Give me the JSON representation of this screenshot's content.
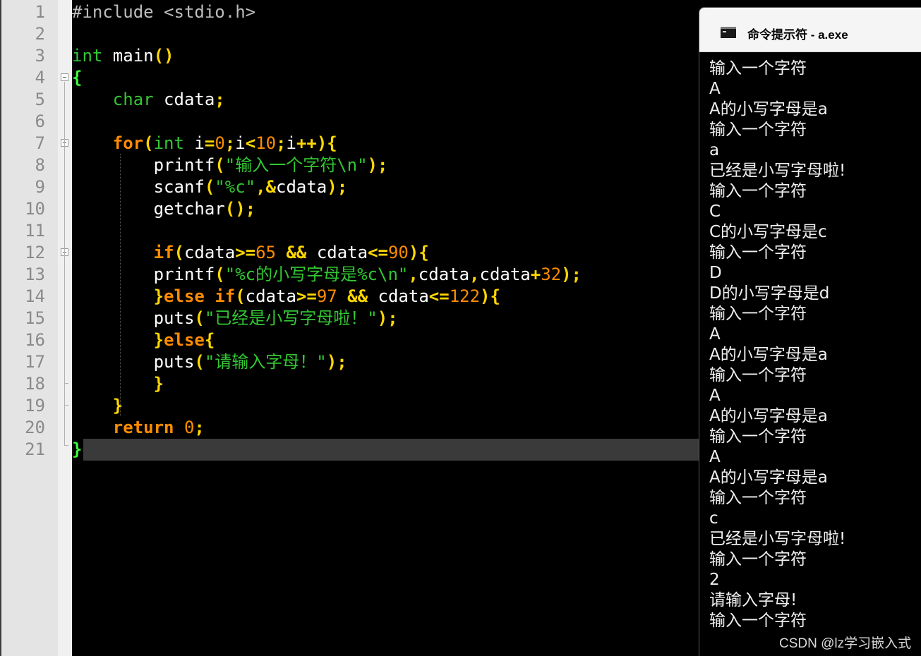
{
  "editor": {
    "code_lines": [
      [
        {
          "t": "#include <stdio.h>",
          "c": "pre"
        }
      ],
      [],
      [
        {
          "t": "int",
          "c": "type"
        },
        {
          "t": " main",
          "c": "id"
        },
        {
          "t": "()",
          "c": "op"
        }
      ],
      [
        {
          "t": "{",
          "c": "brace"
        }
      ],
      [
        {
          "t": "    ",
          "c": "id"
        },
        {
          "t": "char",
          "c": "type"
        },
        {
          "t": " cdata",
          "c": "id"
        },
        {
          "t": ";",
          "c": "op"
        }
      ],
      [],
      [
        {
          "t": "    ",
          "c": "id"
        },
        {
          "t": "for",
          "c": "kw"
        },
        {
          "t": "(",
          "c": "op"
        },
        {
          "t": "int",
          "c": "type"
        },
        {
          "t": " i",
          "c": "id"
        },
        {
          "t": "=",
          "c": "op"
        },
        {
          "t": "0",
          "c": "num"
        },
        {
          "t": ";",
          "c": "op"
        },
        {
          "t": "i",
          "c": "id"
        },
        {
          "t": "<",
          "c": "op"
        },
        {
          "t": "10",
          "c": "num"
        },
        {
          "t": ";",
          "c": "op"
        },
        {
          "t": "i",
          "c": "id"
        },
        {
          "t": "++){",
          "c": "op"
        }
      ],
      [
        {
          "t": "        printf",
          "c": "id"
        },
        {
          "t": "(",
          "c": "op"
        },
        {
          "t": "\"输入一个字符\\n\"",
          "c": "str"
        },
        {
          "t": ");",
          "c": "op"
        }
      ],
      [
        {
          "t": "        scanf",
          "c": "id"
        },
        {
          "t": "(",
          "c": "op"
        },
        {
          "t": "\"%c\"",
          "c": "str"
        },
        {
          "t": ",&",
          "c": "op"
        },
        {
          "t": "cdata",
          "c": "id"
        },
        {
          "t": ");",
          "c": "op"
        }
      ],
      [
        {
          "t": "        getchar",
          "c": "id"
        },
        {
          "t": "();",
          "c": "op"
        }
      ],
      [],
      [
        {
          "t": "        ",
          "c": "id"
        },
        {
          "t": "if",
          "c": "kw"
        },
        {
          "t": "(",
          "c": "op"
        },
        {
          "t": "cdata",
          "c": "id"
        },
        {
          "t": ">=",
          "c": "op"
        },
        {
          "t": "65",
          "c": "num"
        },
        {
          "t": " ",
          "c": "id"
        },
        {
          "t": "&&",
          "c": "op"
        },
        {
          "t": " cdata",
          "c": "id"
        },
        {
          "t": "<=",
          "c": "op"
        },
        {
          "t": "90",
          "c": "num"
        },
        {
          "t": "){",
          "c": "op"
        }
      ],
      [
        {
          "t": "        printf",
          "c": "id"
        },
        {
          "t": "(",
          "c": "op"
        },
        {
          "t": "\"%c的小写字母是%c\\n\"",
          "c": "str"
        },
        {
          "t": ",",
          "c": "op"
        },
        {
          "t": "cdata",
          "c": "id"
        },
        {
          "t": ",",
          "c": "op"
        },
        {
          "t": "cdata",
          "c": "id"
        },
        {
          "t": "+",
          "c": "op"
        },
        {
          "t": "32",
          "c": "num"
        },
        {
          "t": ");",
          "c": "op"
        }
      ],
      [
        {
          "t": "        ",
          "c": "id"
        },
        {
          "t": "}",
          "c": "op"
        },
        {
          "t": "else",
          "c": "kw"
        },
        {
          "t": " ",
          "c": "id"
        },
        {
          "t": "if",
          "c": "kw"
        },
        {
          "t": "(",
          "c": "op"
        },
        {
          "t": "cdata",
          "c": "id"
        },
        {
          "t": ">=",
          "c": "op"
        },
        {
          "t": "97",
          "c": "num"
        },
        {
          "t": " ",
          "c": "id"
        },
        {
          "t": "&&",
          "c": "op"
        },
        {
          "t": " cdata",
          "c": "id"
        },
        {
          "t": "<=",
          "c": "op"
        },
        {
          "t": "122",
          "c": "num"
        },
        {
          "t": "){",
          "c": "op"
        }
      ],
      [
        {
          "t": "        puts",
          "c": "id"
        },
        {
          "t": "(",
          "c": "op"
        },
        {
          "t": "\"已经是小写字母啦！\"",
          "c": "str"
        },
        {
          "t": ");",
          "c": "op"
        }
      ],
      [
        {
          "t": "        ",
          "c": "id"
        },
        {
          "t": "}",
          "c": "op"
        },
        {
          "t": "else",
          "c": "kw"
        },
        {
          "t": "{",
          "c": "op"
        }
      ],
      [
        {
          "t": "        puts",
          "c": "id"
        },
        {
          "t": "(",
          "c": "op"
        },
        {
          "t": "\"请输入字母！\"",
          "c": "str"
        },
        {
          "t": ");",
          "c": "op"
        }
      ],
      [
        {
          "t": "        ",
          "c": "id"
        },
        {
          "t": "}",
          "c": "op"
        }
      ],
      [
        {
          "t": "    ",
          "c": "id"
        },
        {
          "t": "}",
          "c": "op"
        }
      ],
      [
        {
          "t": "    ",
          "c": "id"
        },
        {
          "t": "return",
          "c": "kw"
        },
        {
          "t": " ",
          "c": "id"
        },
        {
          "t": "0",
          "c": "num"
        },
        {
          "t": ";",
          "c": "op"
        }
      ],
      [
        {
          "t": "}",
          "c": "brace"
        }
      ]
    ]
  },
  "console": {
    "title": "命令提示符 - a.exe",
    "output_lines": [
      "输入一个字符",
      "A",
      "A的小写字母是a",
      "输入一个字符",
      "a",
      "已经是小写字母啦!",
      "输入一个字符",
      "C",
      "C的小写字母是c",
      "输入一个字符",
      "D",
      "D的小写字母是d",
      "输入一个字符",
      "A",
      "A的小写字母是a",
      "输入一个字符",
      "A",
      "A的小写字母是a",
      "输入一个字符",
      "A",
      "A的小写字母是a",
      "输入一个字符",
      "c",
      "已经是小写字母啦!",
      "输入一个字符",
      "2",
      "请输入字母!",
      "输入一个字符"
    ]
  },
  "watermark": "CSDN @lz学习嵌入式",
  "colors": {
    "background": "#000000",
    "keyword": "#ff8c00",
    "type": "#32c832",
    "string": "#32c832",
    "operator": "#ffd700",
    "number": "#ff8c00",
    "brace": "#3cff3c",
    "preprocessor": "#bdbdbd"
  },
  "icons": {
    "console": "terminal-icon",
    "fold": "fold-minus-icon"
  }
}
